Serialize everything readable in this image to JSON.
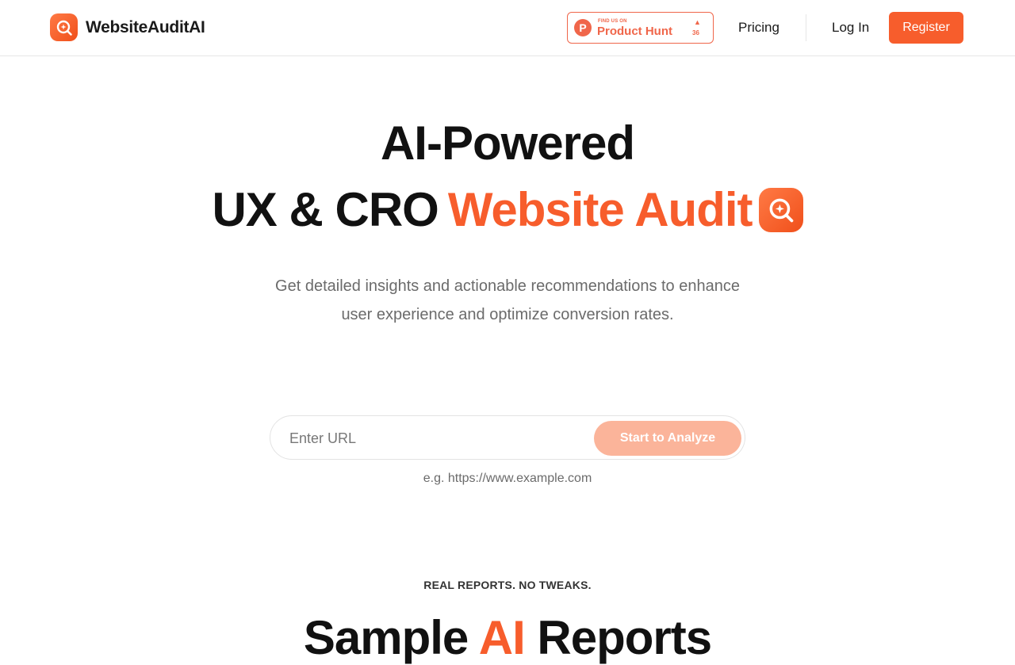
{
  "header": {
    "brand": "WebsiteAuditAI",
    "brand_icon": "magnifier-logo-icon",
    "product_hunt": {
      "small_label": "FIND US ON",
      "label": "Product Hunt",
      "logo_letter": "P",
      "upvote_arrow": "▲",
      "count": "36"
    },
    "nav": {
      "pricing": "Pricing",
      "login": "Log In",
      "register": "Register"
    }
  },
  "hero": {
    "line1": "AI-Powered",
    "line2_dark": "UX & CRO",
    "line2_orange": "Website Audit",
    "subtitle_line1": "Get detailed insights and actionable recommendations to enhance",
    "subtitle_line2": "user experience and optimize conversion rates."
  },
  "url_form": {
    "placeholder": "Enter URL",
    "button": "Start to Analyze",
    "example": "e.g. https://www.example.com"
  },
  "samples": {
    "kicker": "REAL REPORTS. NO TWEAKS.",
    "title_part1": "Sample ",
    "title_orange": "AI",
    "title_part2": " Reports"
  },
  "colors": {
    "accent": "#f75d2c",
    "accent_light": "#fbb49a",
    "text_dark": "#111111",
    "text_muted": "#6b6b6b"
  }
}
